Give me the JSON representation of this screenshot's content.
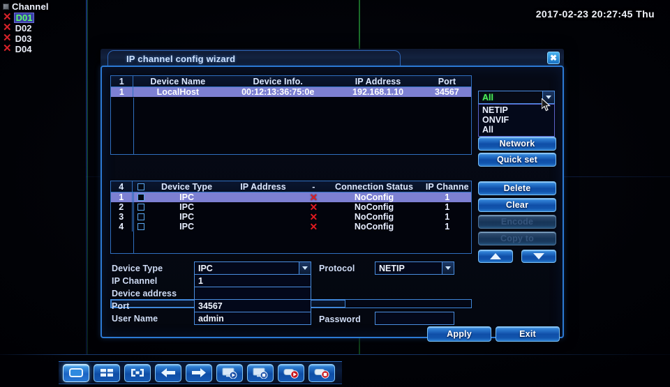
{
  "overlay": {
    "channel_header": "Channel",
    "channels": [
      {
        "name": "D01",
        "status_icon": "red-x-icon",
        "active": true
      },
      {
        "name": "D02",
        "status_icon": "red-x-icon",
        "active": false
      },
      {
        "name": "D03",
        "status_icon": "red-x-icon",
        "active": false
      },
      {
        "name": "D04",
        "status_icon": "red-x-icon",
        "active": false
      }
    ],
    "timestamp": "2017-02-23 20:27:45 Thu"
  },
  "dialog": {
    "title": "IP channel config wizard",
    "close_label": "✖"
  },
  "device_table": {
    "count": "1",
    "headers": {
      "index": "1",
      "device_name": "Device Name",
      "device_info": "Device Info.",
      "ip_address": "IP Address",
      "port": "Port"
    },
    "rows": [
      {
        "index": "1",
        "device_name": "LocalHost",
        "device_info": "00:12:13:36:75:0e",
        "ip_address": "192.168.1.10",
        "port": "34567",
        "selected": true
      }
    ]
  },
  "filter": {
    "selected": "All",
    "options": [
      "NETIP",
      "ONVIF",
      "All"
    ]
  },
  "side_buttons": {
    "network": "Network",
    "quick_set": "Quick set",
    "delete": "Delete",
    "clear": "Clear",
    "encode": "Encode",
    "copy_to": "Copy to",
    "move_up": "up-arrow-icon",
    "move_down": "down-arrow-icon"
  },
  "channel_table": {
    "count": "4",
    "headers": {
      "index": "4",
      "checkbox": "select-all-checkbox",
      "device_type": "Device Type",
      "ip_address": "IP Address",
      "dash": "-",
      "connection_status": "Connection Status",
      "ip_channel": "IP Channe"
    },
    "rows": [
      {
        "index": "1",
        "device_type": "IPC",
        "ip_address": "",
        "status_icon": "red-x-icon",
        "connection_status": "NoConfig",
        "ip_channel": "1",
        "selected": true
      },
      {
        "index": "2",
        "device_type": "IPC",
        "ip_address": "",
        "status_icon": "red-x-icon",
        "connection_status": "NoConfig",
        "ip_channel": "1",
        "selected": false
      },
      {
        "index": "3",
        "device_type": "IPC",
        "ip_address": "",
        "status_icon": "red-x-icon",
        "connection_status": "NoConfig",
        "ip_channel": "1",
        "selected": false
      },
      {
        "index": "4",
        "device_type": "IPC",
        "ip_address": "",
        "status_icon": "red-x-icon",
        "connection_status": "NoConfig",
        "ip_channel": "1",
        "selected": false
      }
    ]
  },
  "form": {
    "device_type_label": "Device Type",
    "device_type_value": "IPC",
    "protocol_label": "Protocol",
    "protocol_value": "NETIP",
    "ip_channel_label": "IP Channel",
    "ip_channel_value": "1",
    "device_address_label": "Device address",
    "device_address_value": "",
    "port_label": "Port",
    "port_value": "34567",
    "user_name_label": "User Name",
    "user_name_value": "admin",
    "password_label": "Password",
    "password_value": ""
  },
  "footer": {
    "apply": "Apply",
    "exit": "Exit"
  },
  "taskbar": {
    "buttons": [
      {
        "name": "single-view-icon",
        "active": true
      },
      {
        "name": "quad-view-icon",
        "active": false
      },
      {
        "name": "fullscreen-icon",
        "active": false
      },
      {
        "name": "back-arrow-icon",
        "active": false
      },
      {
        "name": "forward-arrow-icon",
        "active": false
      },
      {
        "name": "playback-monitor-icon",
        "active": false
      },
      {
        "name": "record-monitor-icon",
        "active": false
      },
      {
        "name": "play-record-icon",
        "active": false
      },
      {
        "name": "stop-record-icon",
        "active": false
      }
    ]
  },
  "colors": {
    "accent_blue": "#2c7ad4",
    "selection": "#7d80d2",
    "status_error": "#e11b22",
    "dropdown_value": "#4cf05a"
  }
}
